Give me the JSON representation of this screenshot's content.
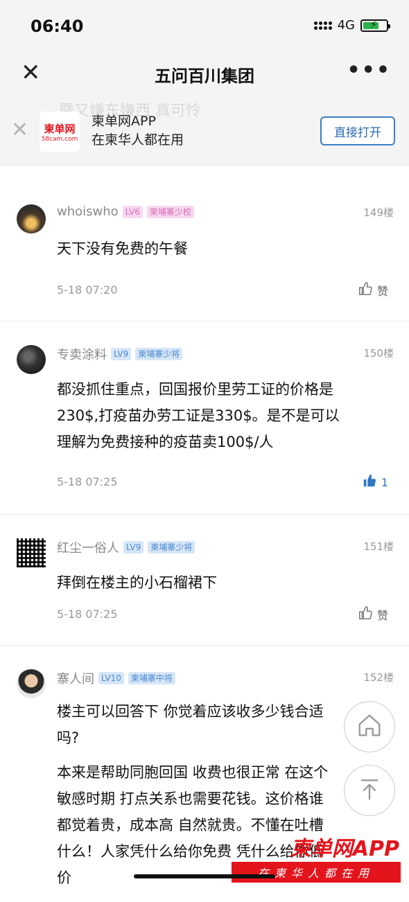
{
  "status": {
    "time": "06:40",
    "network": "4G"
  },
  "nav": {
    "title": "五问百川集团",
    "close_icon": "close-icon",
    "more_icon": "more-icon"
  },
  "banner": {
    "ghost_text": "暨又嫌东嫌西 真可怜",
    "logo_text": "柬单网",
    "logo_sub": "58cam.com",
    "line1": "柬单网APP",
    "line2": "在柬华人都在用",
    "open_label": "直接打开"
  },
  "posts": [
    {
      "user": "whoiswho",
      "level": "LV6",
      "rank": "柬埔寨少校",
      "floor": "149楼",
      "content": [
        "天下没有免费的午餐"
      ],
      "date": "5-18 07:20",
      "like_label": "赞",
      "liked": false
    },
    {
      "user": "专卖涂料",
      "level": "LV9",
      "rank": "柬埔寨少将",
      "floor": "150楼",
      "content": [
        "都没抓住重点，回国报价里劳工证的价格是",
        "230$,打疫苗办劳工证是330$。是不是可以",
        "理解为免费接种的疫苗卖100$/人"
      ],
      "date": "5-18 07:25",
      "like_label": "1",
      "liked": true
    },
    {
      "user": "红尘一俗人",
      "level": "LV9",
      "rank": "柬埔寨少将",
      "floor": "151楼",
      "content": [
        "拜倒在楼主的小石榴裙下"
      ],
      "date": "5-18 07:25",
      "like_label": "赞",
      "liked": false
    },
    {
      "user": "寨人间",
      "level": "LV10",
      "rank": "柬埔寨中将",
      "floor": "152楼",
      "content": [
        "楼主可以回答下 你觉着应该收多少钱合适",
        "吗?"
      ],
      "content2": [
        "本来是帮助同胞回国 收费也很正常 在这个",
        "敏感时期 打点关系也需要花钱。这价格谁",
        "都觉着贵，成本高 自然就贵。不懂在吐槽",
        "什么！人家凭什么给你免费 凭什么给你低",
        "价"
      ]
    }
  ],
  "watermark": {
    "top": "柬单网APP",
    "bottom": "在柬华人都在用"
  },
  "colors": {
    "accent": "#3a7ec6",
    "brand_red": "#e4141c",
    "like_blue": "#2f78c4"
  }
}
